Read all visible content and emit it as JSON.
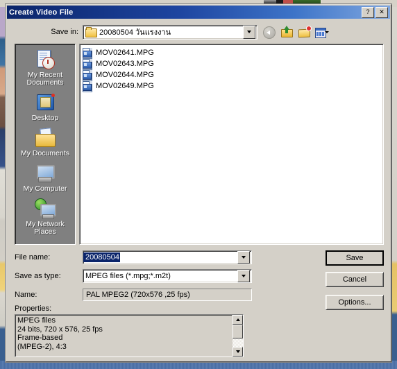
{
  "window": {
    "title": "Create Video File",
    "help_button": "?",
    "close_button": "✕"
  },
  "toolbar": {
    "savein_label": "Save in:",
    "current_folder": "20080504 วันแรงงาน",
    "icons": [
      {
        "name": "back-icon",
        "tooltip": "Back",
        "enabled": false
      },
      {
        "name": "up-one-level-icon",
        "tooltip": "Up One Level",
        "enabled": true
      },
      {
        "name": "new-folder-icon",
        "tooltip": "Create New Folder",
        "enabled": true
      },
      {
        "name": "views-icon",
        "tooltip": "Views",
        "enabled": true
      }
    ]
  },
  "places_bar": {
    "items": [
      {
        "label": "My Recent Documents",
        "icon": "recent-documents-icon"
      },
      {
        "label": "Desktop",
        "icon": "desktop-icon"
      },
      {
        "label": "My Documents",
        "icon": "my-documents-icon"
      },
      {
        "label": "My Computer",
        "icon": "my-computer-icon"
      },
      {
        "label": "My Network Places",
        "icon": "my-network-places-icon"
      }
    ]
  },
  "file_list": {
    "files": [
      {
        "name": "MOV02641.MPG",
        "icon": "mpeg-file-icon"
      },
      {
        "name": "MOV02643.MPG",
        "icon": "mpeg-file-icon"
      },
      {
        "name": "MOV02644.MPG",
        "icon": "mpeg-file-icon"
      },
      {
        "name": "MOV02649.MPG",
        "icon": "mpeg-file-icon"
      }
    ]
  },
  "form": {
    "file_name_label": "File name:",
    "file_name_value": "20080504",
    "save_as_type_label": "Save as type:",
    "save_as_type_value": "MPEG files (*.mpg;*.m2t)",
    "name_label": "Name:",
    "name_value": "PAL   MPEG2 (720x576 ,25 fps)",
    "properties_label": "Properties:",
    "properties_lines": [
      "MPEG files",
      "24 bits, 720 x 576, 25 fps",
      "Frame-based",
      "(MPEG-2),  4:3"
    ]
  },
  "buttons": {
    "save": "Save",
    "cancel": "Cancel",
    "options": "Options..."
  },
  "colors": {
    "titlebar_start": "#0a246a",
    "titlebar_end": "#7fa7e0",
    "dialog_face": "#d4d0c8",
    "places_bar": "#808080",
    "selection": "#0a246a",
    "desktop_blue": "#4a6fa0"
  }
}
